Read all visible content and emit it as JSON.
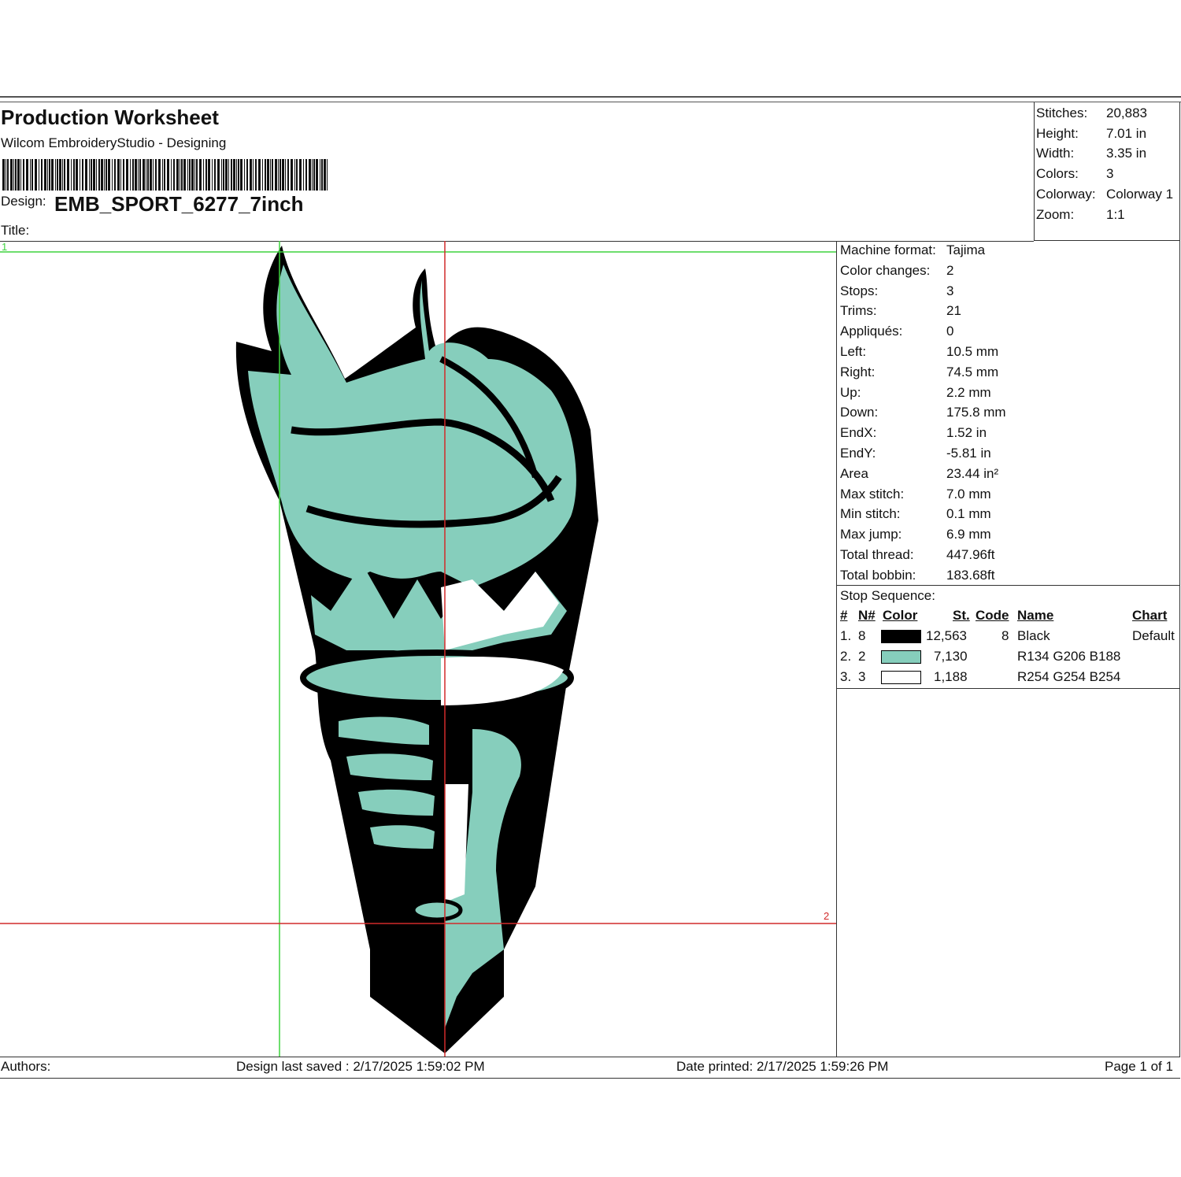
{
  "header": {
    "title": "Production Worksheet",
    "software": "Wilcom EmbroideryStudio - Designing",
    "design_label": "Design:",
    "design_name": "EMB_SPORT_6277_7inch",
    "title_label": "Title:"
  },
  "summary": [
    {
      "label": "Stitches:",
      "value": "20,883"
    },
    {
      "label": "Height:",
      "value": "7.01 in"
    },
    {
      "label": "Width:",
      "value": "3.35 in"
    },
    {
      "label": "Colors:",
      "value": "3"
    },
    {
      "label": "Colorway:",
      "value": "Colorway 1"
    },
    {
      "label": "Zoom:",
      "value": "1:1"
    }
  ],
  "machine_info": [
    {
      "label": "Machine format:",
      "value": "Tajima"
    },
    {
      "label": "Color changes:",
      "value": "2"
    },
    {
      "label": "Stops:",
      "value": "3"
    },
    {
      "label": "Trims:",
      "value": "21"
    },
    {
      "label": "Appliqués:",
      "value": "0"
    },
    {
      "label": "Left:",
      "value": "10.5 mm"
    },
    {
      "label": "Right:",
      "value": "74.5 mm"
    },
    {
      "label": "Up:",
      "value": "2.2 mm"
    },
    {
      "label": "Down:",
      "value": "175.8 mm"
    },
    {
      "label": "EndX:",
      "value": "1.52 in"
    },
    {
      "label": "EndY:",
      "value": "-5.81 in"
    },
    {
      "label": "Area",
      "value": " 23.44 in²"
    },
    {
      "label": "Max stitch:",
      "value": "7.0 mm"
    },
    {
      "label": "Min stitch:",
      "value": "0.1 mm"
    },
    {
      "label": "Max jump:",
      "value": "6.9 mm"
    },
    {
      "label": "Total thread:",
      "value": "447.96ft"
    },
    {
      "label": "Total bobbin:",
      "value": "183.68ft"
    }
  ],
  "stop_sequence": {
    "title": "Stop Sequence:",
    "headers": {
      "num": "#",
      "n": "N#",
      "color": "Color",
      "st": "St.",
      "code": "Code",
      "name": "Name",
      "chart": "Chart"
    },
    "rows": [
      {
        "num": "1.",
        "n": "8",
        "swatch": "#000000",
        "stitches": "12,563",
        "code": "8",
        "name": "Black",
        "chart": "Default"
      },
      {
        "num": "2.",
        "n": "2",
        "swatch": "#86CEBC",
        "stitches": "7,130",
        "code": "",
        "name": "R134 G206 B188",
        "chart": ""
      },
      {
        "num": "3.",
        "n": "3",
        "swatch": "#FEFEFE",
        "stitches": "1,188",
        "code": "",
        "name": "R254 G254 B254",
        "chart": ""
      }
    ]
  },
  "guides": {
    "green_marker": "1",
    "red_marker": "2"
  },
  "colors": {
    "black": "#000000",
    "teal": "#86CEBC",
    "white": "#FEFEFE",
    "guide_green": "#3fd43f",
    "guide_red": "#d12a2a"
  },
  "footer": {
    "authors": "Authors:",
    "saved": "Design last saved : 2/17/2025 1:59:02 PM",
    "printed": "Date printed: 2/17/2025 1:59:26 PM",
    "page": "Page 1 of 1"
  }
}
